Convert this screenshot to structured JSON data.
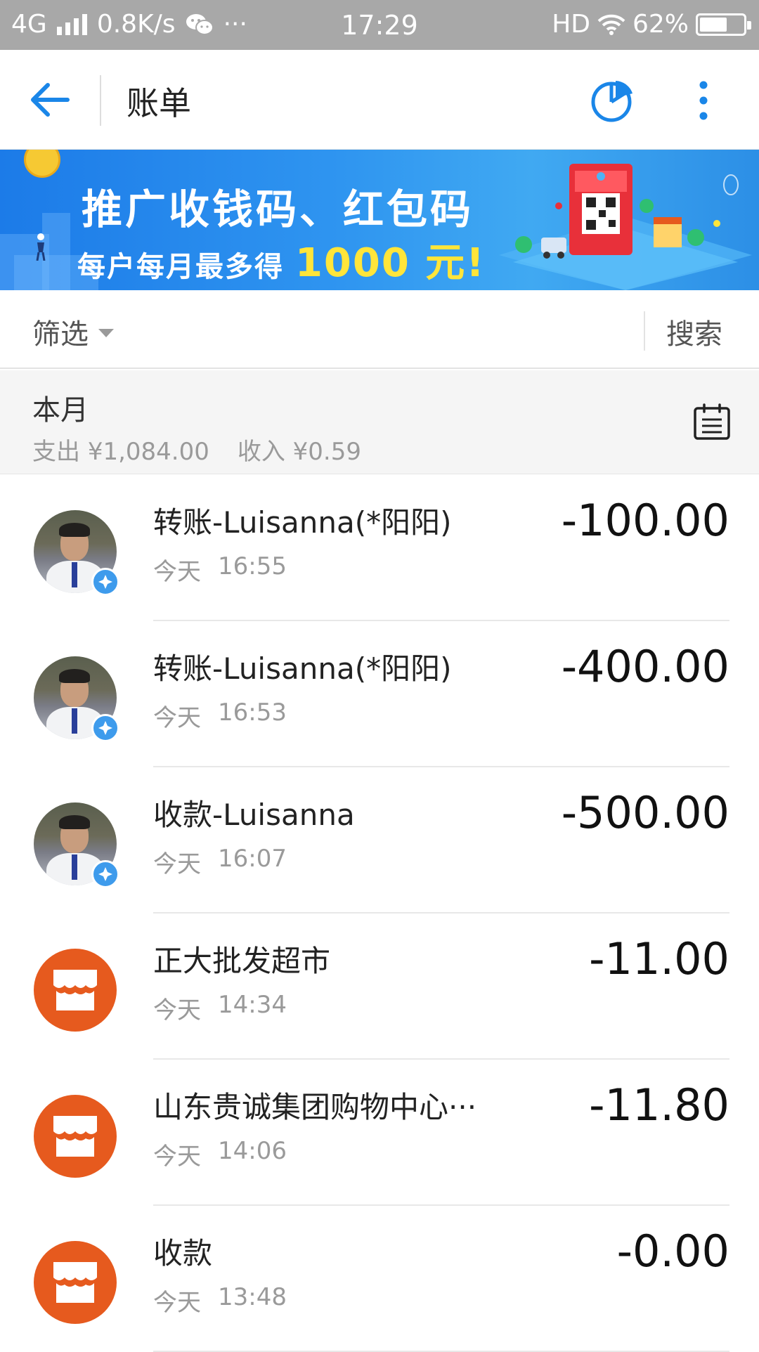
{
  "status_bar": {
    "network": "4G",
    "speed": "0.8K/s",
    "more": "···",
    "time": "17:29",
    "hd": "HD",
    "battery": "62%",
    "battery_level": 0.62
  },
  "nav": {
    "title": "账单",
    "back_icon": "back-arrow-icon",
    "chart_icon": "pie-chart-icon",
    "more_icon": "more-vertical-icon"
  },
  "banner": {
    "line1": "推广收钱码、红包码",
    "line2_prefix": "每户每月最多得",
    "line2_amount": "1000 元!"
  },
  "filter": {
    "filter_label": "筛选",
    "search_label": "搜索"
  },
  "month": {
    "title": "本月",
    "expense_label": "支出",
    "expense_value": "¥1,084.00",
    "income_label": "收入",
    "income_value": "¥0.59",
    "calendar_icon": "calendar-icon"
  },
  "transactions": [
    {
      "name": "转账-Luisanna(*阳阳)",
      "day": "今天",
      "time": "16:55",
      "amount": "-100.00",
      "avatar": "person"
    },
    {
      "name": "转账-Luisanna(*阳阳)",
      "day": "今天",
      "time": "16:53",
      "amount": "-400.00",
      "avatar": "person"
    },
    {
      "name": "收款-Luisanna",
      "day": "今天",
      "time": "16:07",
      "amount": "-500.00",
      "avatar": "person"
    },
    {
      "name": "正大批发超市",
      "day": "今天",
      "time": "14:34",
      "amount": "-11.00",
      "avatar": "store"
    },
    {
      "name": "山东贵诚集团购物中心···",
      "day": "今天",
      "time": "14:06",
      "amount": "-11.80",
      "avatar": "store"
    },
    {
      "name": "收款",
      "day": "今天",
      "time": "13:48",
      "amount": "-0.00",
      "avatar": "store"
    }
  ],
  "colors": {
    "accent": "#1a86e8",
    "store_orange": "#e65a1e",
    "status_bar": "#a8a8a8",
    "banner_yellow": "#ffe53a"
  }
}
